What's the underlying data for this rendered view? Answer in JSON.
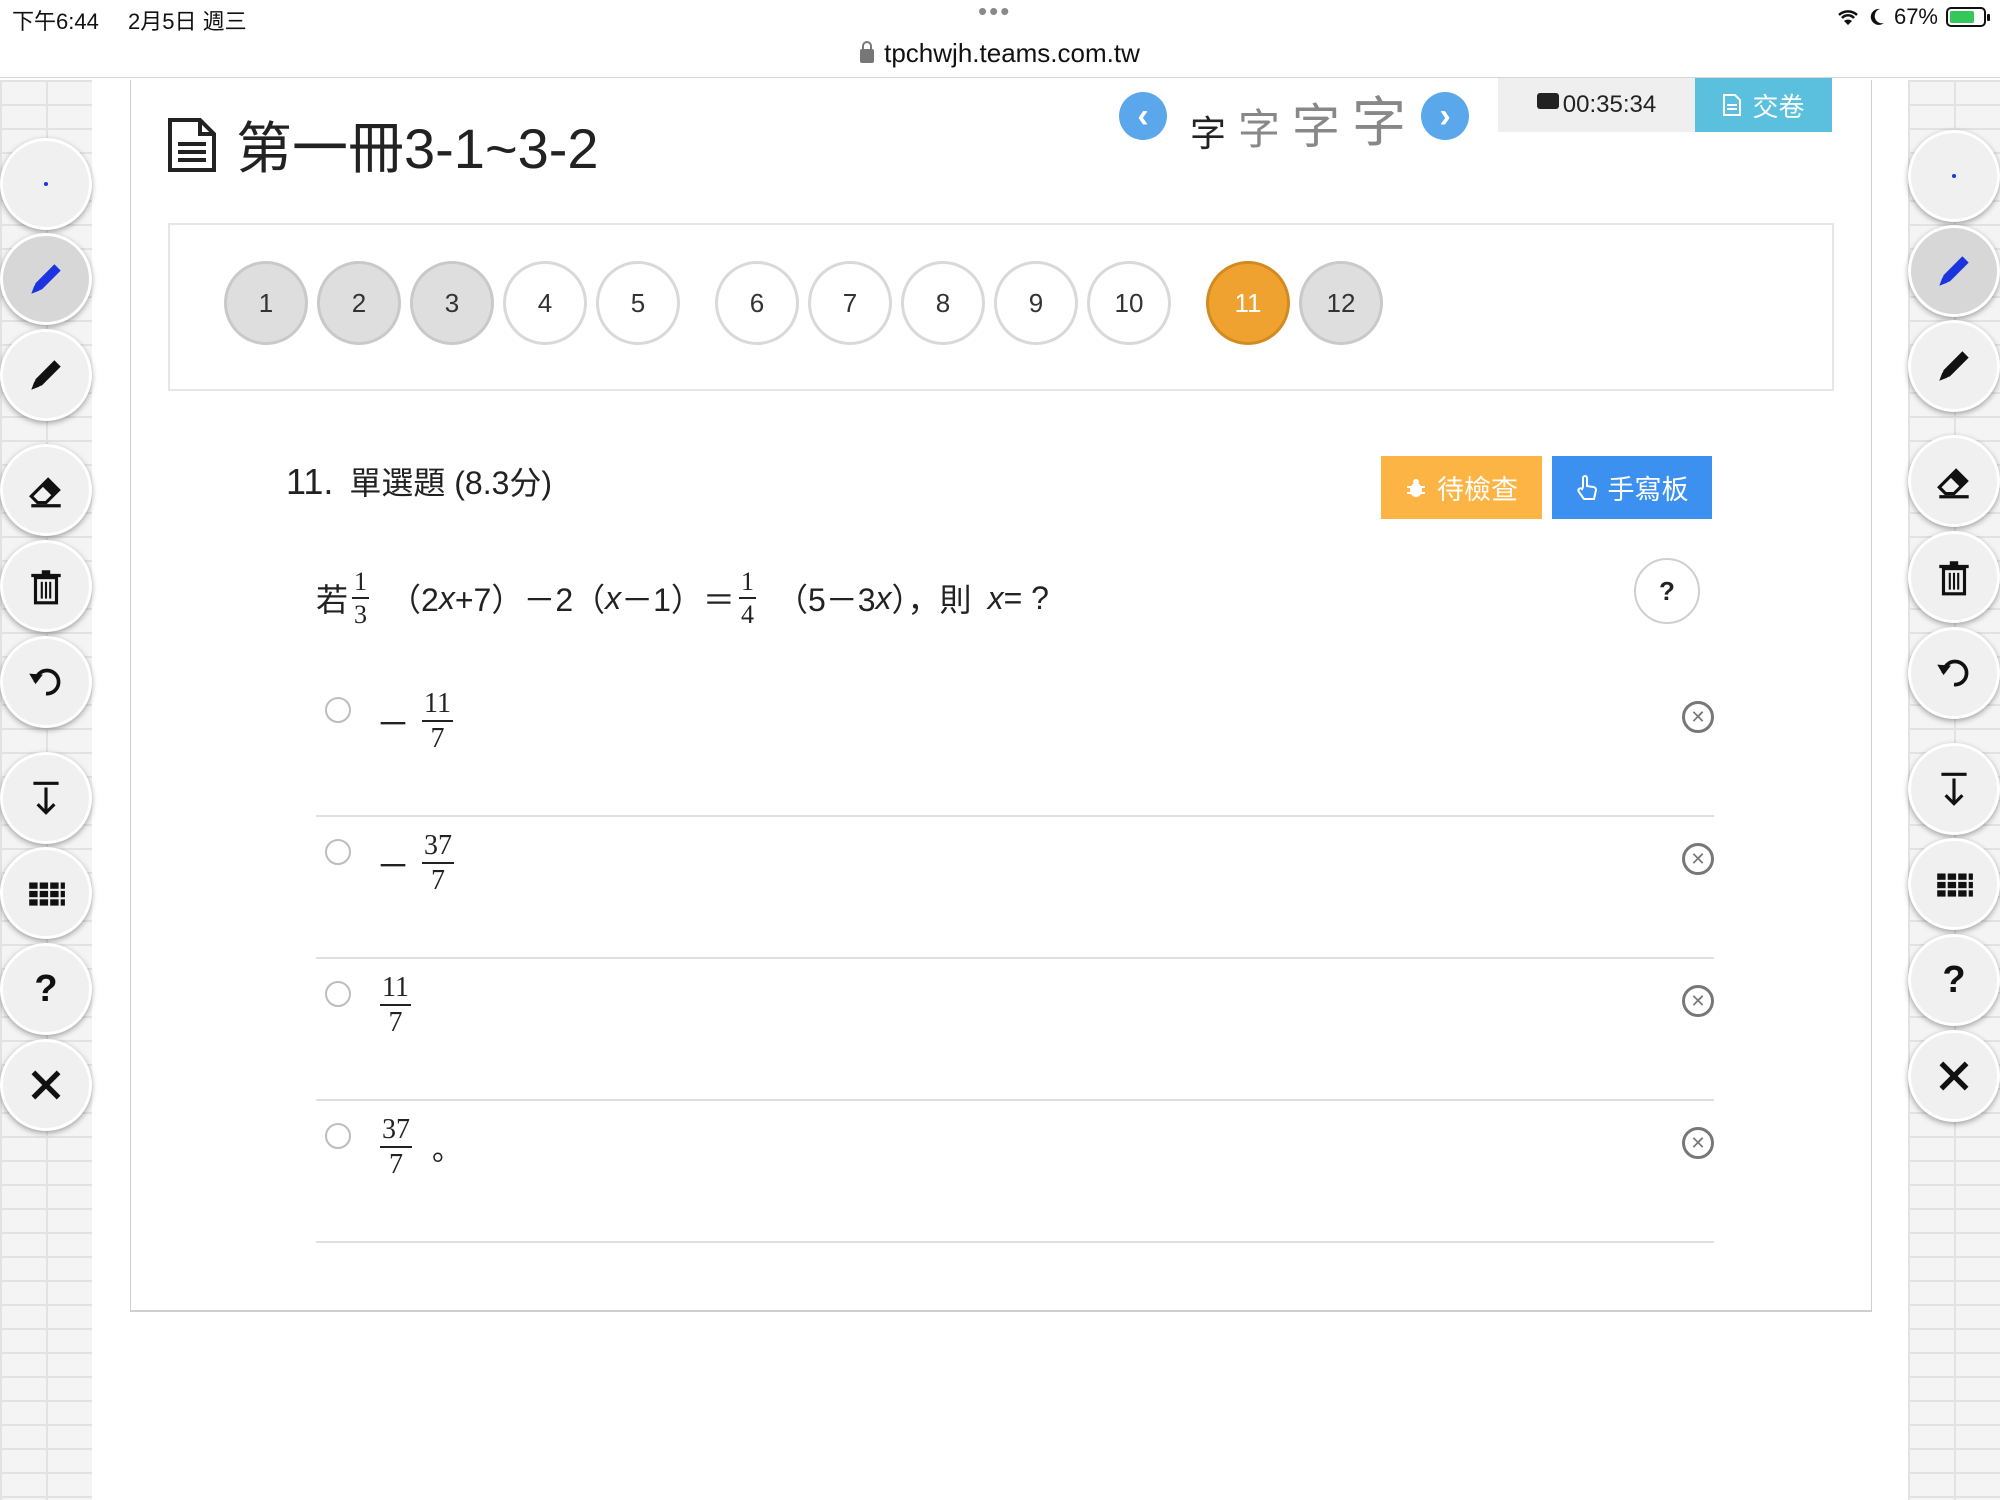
{
  "status_bar": {
    "time": "下午6:44",
    "date": "2月5日 週三",
    "dots": "•••",
    "battery": "67%",
    "url": "tpchwjh.teams.com.tw"
  },
  "header": {
    "title": "第一冊3-1~3-2",
    "font_sizes": [
      "字",
      "字",
      "字",
      "字"
    ],
    "timer": "00:35:34",
    "submit": "交卷"
  },
  "questions": [
    {
      "num": "1",
      "state": "done"
    },
    {
      "num": "2",
      "state": "done"
    },
    {
      "num": "3",
      "state": "done"
    },
    {
      "num": "4",
      "state": "empty"
    },
    {
      "num": "5",
      "state": "empty"
    },
    {
      "num": "6",
      "state": "empty"
    },
    {
      "num": "7",
      "state": "empty"
    },
    {
      "num": "8",
      "state": "empty"
    },
    {
      "num": "9",
      "state": "empty"
    },
    {
      "num": "10",
      "state": "empty"
    },
    {
      "num": "11",
      "state": "current"
    },
    {
      "num": "12",
      "state": "done"
    }
  ],
  "question": {
    "number": "11.",
    "type": "單選題 (8.3分)",
    "review_label": "待檢查",
    "handwrite_label": "手寫板",
    "help": "?",
    "stem": {
      "prefix": "若",
      "f1_num": "1",
      "f1_den": "3",
      "part1": "（2",
      "x": "x",
      "part2": "+7）－2（",
      "part3": "－1）＝",
      "f2_num": "1",
      "f2_den": "4",
      "part4": "（5－3",
      "part5": "），則",
      "part6": "= ?"
    },
    "options": [
      {
        "sign": "－",
        "num": "11",
        "den": "7",
        "tail": ""
      },
      {
        "sign": "－",
        "num": "37",
        "den": "7",
        "tail": ""
      },
      {
        "sign": "",
        "num": "11",
        "den": "7",
        "tail": ""
      },
      {
        "sign": "",
        "num": "37",
        "den": "7",
        "tail": "。"
      }
    ]
  },
  "tools_left": [
    "dot-icon",
    "pen-blue-icon",
    "pen-icon",
    "eraser-icon",
    "trash-icon",
    "undo-icon",
    "download-icon",
    "grid-icon",
    "help-icon",
    "close-icon"
  ],
  "tools_right": [
    "dot-icon",
    "pen-blue-icon",
    "pen-icon",
    "eraser-icon",
    "trash-icon",
    "undo-icon",
    "download-icon",
    "grid-icon",
    "help-icon",
    "close-icon"
  ],
  "colors": {
    "current_question": "#efa22f",
    "review_button": "#fcb444",
    "handwrite_button": "#3c91f0",
    "submit_button": "#5bc0de",
    "nav_arrow": "#5aa7ec"
  }
}
